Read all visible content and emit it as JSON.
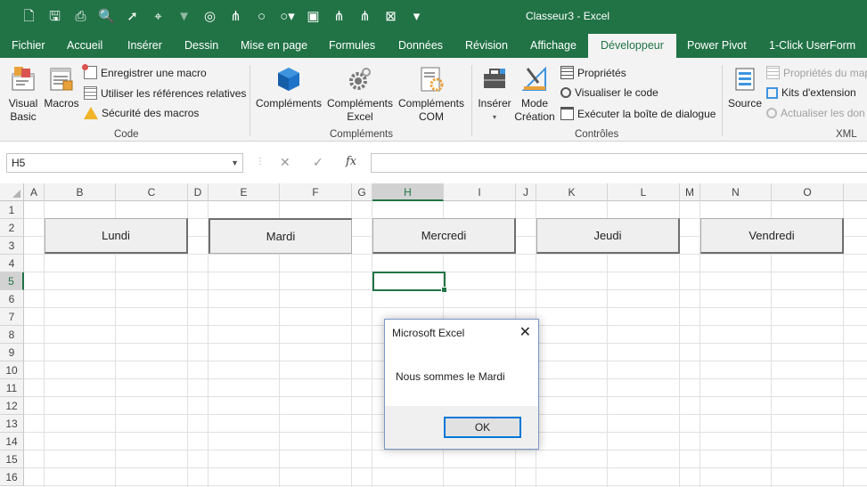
{
  "window": {
    "title": "Classeur3  -  Excel"
  },
  "quick_access": [
    "new-file-icon",
    "save-icon",
    "print-icon",
    "print-preview-icon",
    "select-arrow-icon",
    "cursor-select-icon",
    "filter-icon",
    "target-icon",
    "hierarchy-icon",
    "circle-icon",
    "circle-dropdown-icon",
    "window-icon",
    "hierarchy-icon-2",
    "hierarchy-icon-3",
    "excel-icon",
    "customize-qat-icon"
  ],
  "tabs": [
    "Fichier",
    "Accueil",
    "Insérer",
    "Dessin",
    "Mise en page",
    "Formules",
    "Données",
    "Révision",
    "Affichage",
    "Développeur",
    "Power Pivot",
    "1-Click UserForm"
  ],
  "active_tab": "Développeur",
  "ribbon": {
    "code": {
      "label": "Code",
      "visual_basic": [
        "Visual",
        "Basic"
      ],
      "macros": "Macros",
      "record_macro": "Enregistrer une macro",
      "relative_refs": "Utiliser les références relatives",
      "macro_security": "Sécurité des macros"
    },
    "complements": {
      "label": "Compléments",
      "complements": "Compléments",
      "excel_complements": [
        "Compléments",
        "Excel"
      ],
      "com_complements": [
        "Compléments",
        "COM"
      ]
    },
    "controles": {
      "label": "Contrôles",
      "inserer": "Insérer",
      "mode_creation": [
        "Mode",
        "Création"
      ],
      "proprietes": "Propriétés",
      "visualiser_code": "Visualiser le code",
      "executer_dialogue": "Exécuter la boîte de dialogue"
    },
    "xml": {
      "label": "XML",
      "source": "Source",
      "map_properties": "Propriétés du map",
      "extension_packs": "Kits d'extension",
      "refresh_data": "Actualiser les don"
    }
  },
  "formula_bar": {
    "name_box": "H5",
    "fx": "fx",
    "formula": ""
  },
  "sheet": {
    "columns": [
      "A",
      "B",
      "C",
      "D",
      "E",
      "F",
      "G",
      "H",
      "I",
      "J",
      "K",
      "L",
      "M",
      "N",
      "O"
    ],
    "rows": [
      "1",
      "2",
      "3",
      "4",
      "5",
      "6",
      "7",
      "8",
      "9",
      "10",
      "11",
      "12",
      "13",
      "14",
      "15",
      "16"
    ],
    "selected_column": "H",
    "selected_row": "5"
  },
  "day_buttons": [
    "Lundi",
    "Mardi",
    "Mercredi",
    "Jeudi",
    "Vendredi"
  ],
  "dialog": {
    "title": "Microsoft Excel",
    "message": "Nous sommes le Mardi",
    "ok_label": "OK"
  }
}
